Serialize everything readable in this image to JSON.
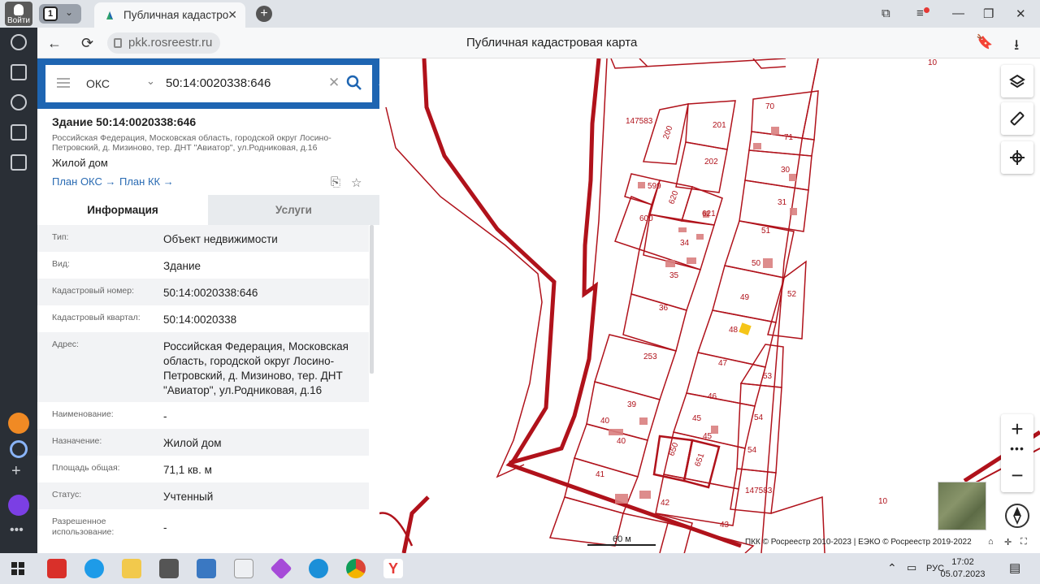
{
  "browser": {
    "login_label": "Войти",
    "tab_count": "1",
    "active_tab_title": "Публичная кадастровая карта",
    "new_tab_label": "+",
    "url": "pkk.rosreestr.ru",
    "page_title": "Публичная кадастровая карта"
  },
  "search": {
    "type": "ОКС",
    "value": "50:14:0020338:646"
  },
  "object": {
    "title": "Здание 50:14:0020338:646",
    "address_short": "Российская Федерация, Московская область, городской округ Лосино-Петровский, д. Мизиново, тер. ДНТ \"Авиатор\", ул.Родниковая, д.16",
    "kind": "Жилой дом",
    "plan_oks": "План ОКС →",
    "plan_kk": "План КК →"
  },
  "tabs": {
    "info": "Информация",
    "services": "Услуги"
  },
  "rows": [
    {
      "key": "Тип:",
      "value": "Объект недвижимости"
    },
    {
      "key": "Вид:",
      "value": "Здание"
    },
    {
      "key": "Кадастровый номер:",
      "value": "50:14:0020338:646"
    },
    {
      "key": "Кадастровый квартал:",
      "value": "50:14:0020338"
    },
    {
      "key": "Адрес:",
      "value": "Российская Федерация, Московская область, городской округ Лосино-Петровский, д. Мизиново, тер. ДНТ \"Авиатор\", ул.Родниковая, д.16"
    },
    {
      "key": "Наименование:",
      "value": "-"
    },
    {
      "key": "Назначение:",
      "value": "Жилой дом"
    },
    {
      "key": "Площадь общая:",
      "value": "71,1 кв. м"
    },
    {
      "key": "Статус:",
      "value": "Учтенный"
    },
    {
      "key": "Разрешенное использование:",
      "value": "-"
    }
  ],
  "map": {
    "parcel_labels": [
      "10",
      "147583",
      "200",
      "201",
      "202",
      "70",
      "71",
      "30",
      "31",
      "599",
      "620",
      "621",
      "600",
      "34",
      "51",
      "50",
      "35",
      "49",
      "52",
      "36",
      "48",
      "253",
      "47",
      "53",
      "46",
      "39",
      "45",
      "54",
      "40",
      "45",
      "40",
      "650",
      "651",
      "54",
      "41",
      "147583",
      "42",
      "10",
      "43"
    ],
    "scale_label": "60 м",
    "copyright": "ПКК © Росреестр 2010-2023 | ЕЭКО © Росреестр 2019-2022",
    "parcel_color": "#b0121b",
    "selected_color": "#f5c518"
  },
  "taskbar": {
    "language": "РУС",
    "time": "17:02",
    "date": "05.07.2023"
  }
}
